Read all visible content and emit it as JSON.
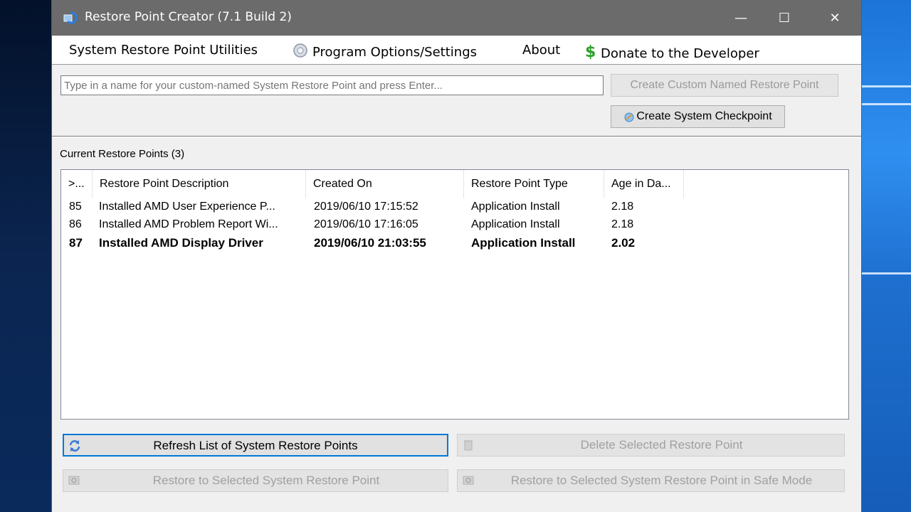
{
  "window": {
    "title": "Restore Point Creator (7.1 Build 2)",
    "controls": {
      "minimize": "—",
      "maximize": "☐",
      "close": "✕"
    }
  },
  "menu": {
    "utilities": "System Restore Point Utilities",
    "options": "Program Options/Settings",
    "about": "About",
    "donate": "Donate to the Developer"
  },
  "custom_point": {
    "input_placeholder": "Type in a name for your custom-named System Restore Point and press Enter...",
    "create_custom_button": "Create Custom Named Restore Point",
    "create_checkpoint_button": "Create System Checkpoint"
  },
  "restore_points": {
    "section_label": "Current Restore Points (3)",
    "columns": [
      ">...",
      "Restore Point Description",
      "Created On",
      "Restore Point Type",
      "Age in Da..."
    ],
    "rows": [
      {
        "id": "85",
        "description": "Installed AMD User Experience P...",
        "created": "2019/06/10 17:15:52",
        "type": "Application Install",
        "age": "2.18"
      },
      {
        "id": "86",
        "description": "Installed AMD Problem Report Wi...",
        "created": "2019/06/10 17:16:05",
        "type": "Application Install",
        "age": "2.18"
      },
      {
        "id": "87",
        "description": "Installed AMD Display Driver",
        "created": "2019/06/10 21:03:55",
        "type": "Application Install",
        "age": "2.02"
      }
    ]
  },
  "actions": {
    "refresh": "Refresh List of System Restore Points",
    "delete": "Delete Selected Restore Point",
    "restore": "Restore to Selected System Restore Point",
    "restore_safe": "Restore to Selected System Restore Point in Safe Mode"
  },
  "colors": {
    "titlebar": "#6b6b6b",
    "focus_border": "#0078d7",
    "disabled_text": "#a0a0a0"
  }
}
